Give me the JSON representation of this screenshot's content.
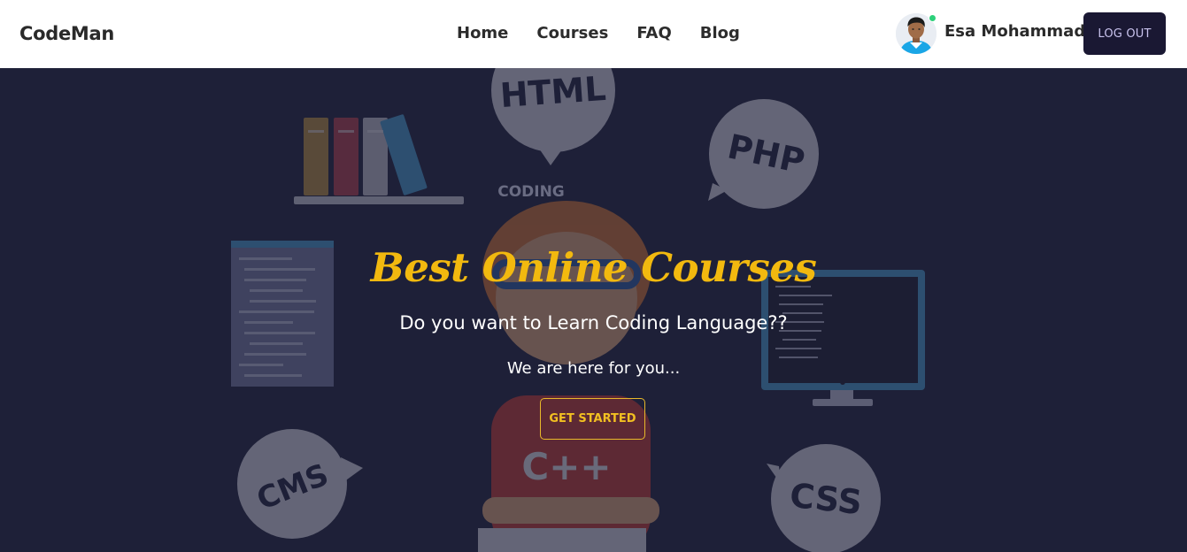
{
  "navbar": {
    "brand": "CodeMan",
    "links": [
      "Home",
      "Courses",
      "FAQ",
      "Blog"
    ],
    "user_name": "Esa Mohammad",
    "logout_label": "LOG OUT"
  },
  "hero": {
    "title": "Best Online Courses",
    "subtitle": "Do you want to Learn Coding Language??",
    "tagline": "We are here for you...",
    "cta_label": "GET STARTED",
    "illustration_labels": {
      "html": "HTML",
      "php": "PHP",
      "coding": "CODING",
      "cms": "CMS",
      "css": "CSS",
      "cpp": "C++"
    }
  },
  "colors": {
    "hero_bg": "#1e2038",
    "accent": "#f2b90f",
    "logout_bg": "#1a1833",
    "online": "#2dd07a"
  }
}
